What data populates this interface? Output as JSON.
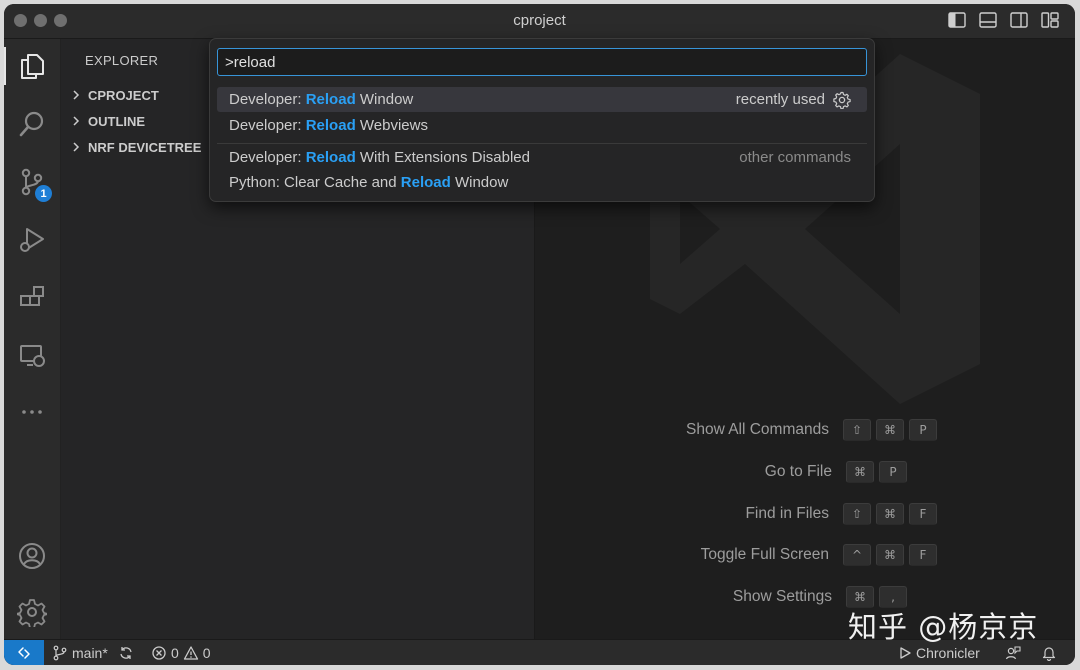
{
  "window": {
    "title": "cproject"
  },
  "sidebar": {
    "header": "EXPLORER",
    "sections": [
      {
        "label": "CPROJECT"
      },
      {
        "label": "OUTLINE"
      },
      {
        "label": "NRF DEVICETREE"
      }
    ]
  },
  "activity_bar": {
    "items": [
      "files-icon",
      "search-icon",
      "source-control-icon",
      "run-debug-icon",
      "extensions-icon",
      "remote-explorer-icon",
      "more-icon"
    ],
    "source_control_badge": "1",
    "bottom": [
      "account-icon",
      "settings-gear-icon"
    ]
  },
  "command_palette": {
    "input_value": ">reload",
    "items": [
      {
        "prefix": "Developer: ",
        "match": "Reload",
        "suffix": " Window",
        "right": "recently used",
        "selected": true
      },
      {
        "prefix": "Developer: ",
        "match": "Reload",
        "suffix": " Webviews",
        "right": ""
      },
      {
        "prefix": "Developer: ",
        "match": "Reload",
        "suffix": " With Extensions Disabled",
        "right": "other commands"
      },
      {
        "prefix": "Python: Clear Cache and ",
        "match": "Reload",
        "suffix": " Window",
        "right": ""
      }
    ]
  },
  "editor": {
    "hints": [
      {
        "label": "Show All Commands",
        "keys": [
          "⇧",
          "⌘",
          "P"
        ]
      },
      {
        "label": "Go to File",
        "keys": [
          "⌘",
          "P"
        ]
      },
      {
        "label": "Find in Files",
        "keys": [
          "⇧",
          "⌘",
          "F"
        ]
      },
      {
        "label": "Toggle Full Screen",
        "keys": [
          "^",
          "⌘",
          "F"
        ]
      },
      {
        "label": "Show Settings",
        "keys": [
          "⌘",
          ","
        ]
      }
    ]
  },
  "status_bar": {
    "branch": "main*",
    "errors": "0",
    "warnings": "0",
    "chronicler": "Chronicler"
  },
  "watermark": "知乎 @杨京京",
  "colors": {
    "accent": "#2aa0f5",
    "remote_indicator": "#1979c9",
    "focus_border": "#3794d8",
    "badge": "#1f7fd6"
  }
}
